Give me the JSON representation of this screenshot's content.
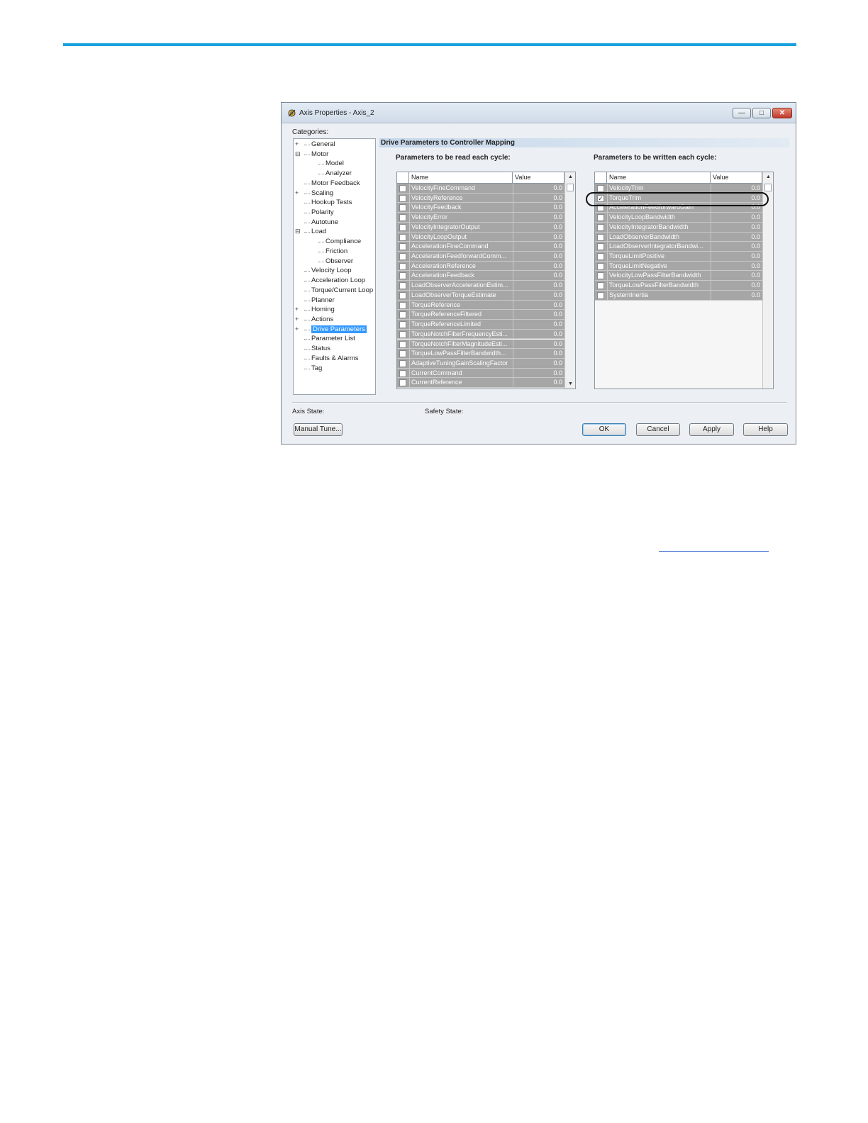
{
  "window": {
    "title": "Axis Properties - Axis_2",
    "title_icon": "axis-gear-icon",
    "controls": {
      "minimize": "—",
      "maximize": "□",
      "close": "✕"
    }
  },
  "categories": {
    "label": "Categories:",
    "items": [
      {
        "label": "General",
        "level": 0,
        "expander": "+"
      },
      {
        "label": "Motor",
        "level": 0,
        "expander": "-"
      },
      {
        "label": "Model",
        "level": 1
      },
      {
        "label": "Analyzer",
        "level": 1
      },
      {
        "label": "Motor Feedback",
        "level": 0
      },
      {
        "label": "Scaling",
        "level": 0,
        "expander": "+"
      },
      {
        "label": "Hookup Tests",
        "level": 0
      },
      {
        "label": "Polarity",
        "level": 0
      },
      {
        "label": "Autotune",
        "level": 0
      },
      {
        "label": "Load",
        "level": 0,
        "expander": "-"
      },
      {
        "label": "Compliance",
        "level": 1
      },
      {
        "label": "Friction",
        "level": 1
      },
      {
        "label": "Observer",
        "level": 1
      },
      {
        "label": "Velocity Loop",
        "level": 0
      },
      {
        "label": "Acceleration Loop",
        "level": 0
      },
      {
        "label": "Torque/Current Loop",
        "level": 0
      },
      {
        "label": "Planner",
        "level": 0
      },
      {
        "label": "Homing",
        "level": 0,
        "expander": "+"
      },
      {
        "label": "Actions",
        "level": 0,
        "expander": "+"
      },
      {
        "label": "Drive Parameters",
        "level": 0,
        "expander": "+",
        "selected": true
      },
      {
        "label": "Parameter List",
        "level": 0
      },
      {
        "label": "Status",
        "level": 0
      },
      {
        "label": "Faults & Alarms",
        "level": 0
      },
      {
        "label": "Tag",
        "level": 0
      }
    ]
  },
  "section_title": "Drive Parameters to Controller Mapping",
  "read_params": {
    "label": "Parameters to be read each cycle:",
    "columns": {
      "name": "Name",
      "value": "Value"
    },
    "rows": [
      {
        "name": "VelocityFineCommand",
        "value": "0.0",
        "checked": false
      },
      {
        "name": "VelocityReference",
        "value": "0.0",
        "checked": false
      },
      {
        "name": "VelocityFeedback",
        "value": "0.0",
        "checked": false
      },
      {
        "name": "VelocityError",
        "value": "0.0",
        "checked": false
      },
      {
        "name": "VelocityIntegratorOutput",
        "value": "0.0",
        "checked": false
      },
      {
        "name": "VelocityLoopOutput",
        "value": "0.0",
        "checked": false
      },
      {
        "name": "AccelerationFineCommand",
        "value": "0.0",
        "checked": false
      },
      {
        "name": "AccelerationFeedforwardComm...",
        "value": "0.0",
        "checked": false
      },
      {
        "name": "AccelerationReference",
        "value": "0.0",
        "checked": false
      },
      {
        "name": "AccelerationFeedback",
        "value": "0.0",
        "checked": false
      },
      {
        "name": "LoadObserverAccelerationEstim...",
        "value": "0.0",
        "checked": false
      },
      {
        "name": "LoadObserverTorqueEstimate",
        "value": "0.0",
        "checked": false
      },
      {
        "name": "TorqueReference",
        "value": "0.0",
        "checked": false
      },
      {
        "name": "TorqueReferenceFiltered",
        "value": "0.0",
        "checked": false
      },
      {
        "name": "TorqueReferenceLimited",
        "value": "0.0",
        "checked": false
      },
      {
        "name": "TorqueNotchFilterFrequencyEsti...",
        "value": "0.0",
        "checked": false
      },
      {
        "name": "TorqueNotchFilterMagnitudeEsti...",
        "value": "0.0",
        "checked": false
      },
      {
        "name": "TorqueLowPassFilterBandwidth...",
        "value": "0.0",
        "checked": false
      },
      {
        "name": "AdaptiveTuningGainScalingFactor",
        "value": "0.0",
        "checked": false
      },
      {
        "name": "CurrentCommand",
        "value": "0.0",
        "checked": false
      },
      {
        "name": "CurrentReference",
        "value": "0.0",
        "checked": false
      }
    ]
  },
  "write_params": {
    "label": "Parameters to be written each cycle:",
    "columns": {
      "name": "Name",
      "value": "Value"
    },
    "rows": [
      {
        "name": "VelocityTrim",
        "value": "0.0",
        "checked": false
      },
      {
        "name": "TorqueTrim",
        "value": "0.0",
        "checked": true
      },
      {
        "name": "AccelerationFeedforwardGain",
        "value": "0.0",
        "checked": false
      },
      {
        "name": "VelocityLoopBandwidth",
        "value": "0.0",
        "checked": false
      },
      {
        "name": "VelocityIntegratorBandwidth",
        "value": "0.0",
        "checked": false
      },
      {
        "name": "LoadObserverBandwidth",
        "value": "0.0",
        "checked": false
      },
      {
        "name": "LoadObserverIntegratorBandwi...",
        "value": "0.0",
        "checked": false
      },
      {
        "name": "TorqueLimitPositive",
        "value": "0.0",
        "checked": false
      },
      {
        "name": "TorqueLimitNegative",
        "value": "0.0",
        "checked": false
      },
      {
        "name": "VelocityLowPassFilterBandwidth",
        "value": "0.0",
        "checked": false
      },
      {
        "name": "TorqueLowPassFilterBandwidth",
        "value": "0.0",
        "checked": false
      },
      {
        "name": "SystemInertia",
        "value": "0.0",
        "checked": false
      }
    ]
  },
  "status": {
    "axis_state_label": "Axis State:",
    "safety_state_label": "Safety State:"
  },
  "buttons": {
    "manual_tune": "Manual Tune...",
    "ok": "OK",
    "cancel": "Cancel",
    "apply": "Apply",
    "help": "Help"
  },
  "colors": {
    "accent_rule": "#19a1dc",
    "selection": "#3399ff",
    "grid_row": "#a6a6a6"
  }
}
